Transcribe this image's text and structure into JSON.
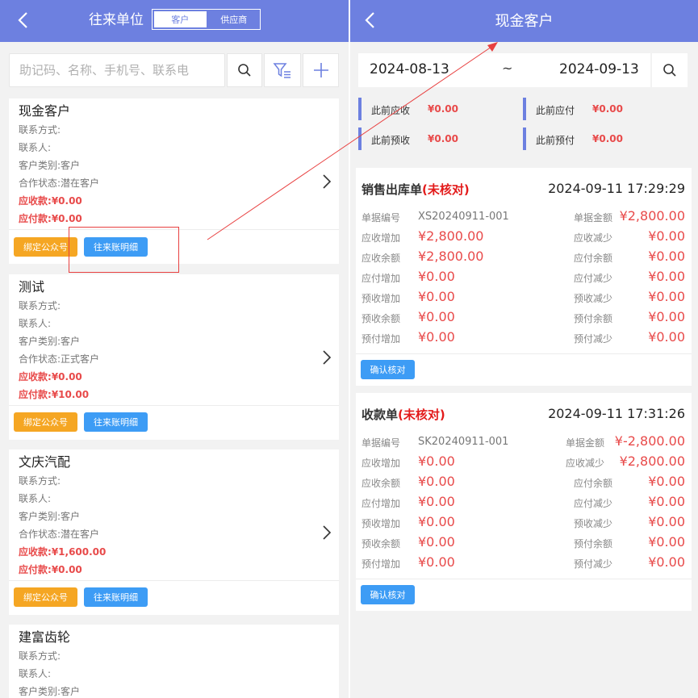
{
  "left": {
    "title": "往来单位",
    "segments": [
      "客户",
      "供应商"
    ],
    "search_placeholder": "助记码、名称、手机号、联系电",
    "labels": {
      "contact_method": "联系方式:",
      "contact_person": "联系人:",
      "category": "客户类别:",
      "status": "合作状态:",
      "receivable": "应收款:",
      "payable": "应付款:"
    },
    "btn_bind": "绑定公众号",
    "btn_detail": "往来账明细",
    "customers": [
      {
        "name": "现金客户",
        "category": "客户",
        "status": "潜在客户",
        "receivable": "¥0.00",
        "payable": "¥0.00"
      },
      {
        "name": "测试",
        "category": "客户",
        "status": "正式客户",
        "receivable": "¥0.00",
        "payable": "¥10.00"
      },
      {
        "name": "文庆汽配",
        "category": "客户",
        "status": "潜在客户",
        "receivable": "¥1,600.00",
        "payable": "¥0.00"
      },
      {
        "name": "建富齿轮",
        "category": "客户"
      }
    ]
  },
  "right": {
    "title": "现金客户",
    "date_from": "2024-08-13",
    "date_sep": "~",
    "date_to": "2024-09-13",
    "summary": [
      {
        "label": "此前应收",
        "value": "¥0.00"
      },
      {
        "label": "此前应付",
        "value": "¥0.00"
      },
      {
        "label": "此前预收",
        "value": "¥0.00"
      },
      {
        "label": "此前预付",
        "value": "¥0.00"
      }
    ],
    "confirm_label": "确认核对",
    "docs": [
      {
        "type": "销售出库单",
        "status": "(未核对)",
        "time": "2024-09-11 17:29:29",
        "rows": [
          {
            "lk": "单据编号",
            "lv": "XS20240911-001",
            "rk": "单据金额",
            "rv": "¥2,800.00"
          },
          {
            "lk": "应收增加",
            "lv": "¥2,800.00",
            "rk": "应收减少",
            "rv": "¥0.00"
          },
          {
            "lk": "应收余额",
            "lv": "¥2,800.00",
            "rk": "应付余额",
            "rv": "¥0.00"
          },
          {
            "lk": "应付增加",
            "lv": "¥0.00",
            "rk": "应付减少",
            "rv": "¥0.00"
          },
          {
            "lk": "预收增加",
            "lv": "¥0.00",
            "rk": "预收减少",
            "rv": "¥0.00"
          },
          {
            "lk": "预收余额",
            "lv": "¥0.00",
            "rk": "预付余额",
            "rv": "¥0.00"
          },
          {
            "lk": "预付增加",
            "lv": "¥0.00",
            "rk": "预付减少",
            "rv": "¥0.00"
          }
        ]
      },
      {
        "type": "收款单",
        "status": "(未核对)",
        "time": "2024-09-11 17:31:26",
        "rows": [
          {
            "lk": "单据编号",
            "lv": "SK20240911-001",
            "rk": "单据金额",
            "rv": "¥-2,800.00"
          },
          {
            "lk": "应收增加",
            "lv": "¥0.00",
            "rk": "应收减少",
            "rv": "¥2,800.00"
          },
          {
            "lk": "应收余额",
            "lv": "¥0.00",
            "rk": "应付余额",
            "rv": "¥0.00"
          },
          {
            "lk": "应付增加",
            "lv": "¥0.00",
            "rk": "应付减少",
            "rv": "¥0.00"
          },
          {
            "lk": "预收增加",
            "lv": "¥0.00",
            "rk": "预收减少",
            "rv": "¥0.00"
          },
          {
            "lk": "预收余额",
            "lv": "¥0.00",
            "rk": "预付余额",
            "rv": "¥0.00"
          },
          {
            "lk": "预付增加",
            "lv": "¥0.00",
            "rk": "预付减少",
            "rv": "¥0.00"
          }
        ]
      }
    ]
  },
  "colors": {
    "header": "#6d80e0",
    "red": "#e84a4a",
    "orange": "#f5a623",
    "blue": "#3d9cf5"
  },
  "icons": [
    "back-icon",
    "search-icon",
    "filter-icon",
    "plus-icon",
    "chevron-right-icon"
  ]
}
